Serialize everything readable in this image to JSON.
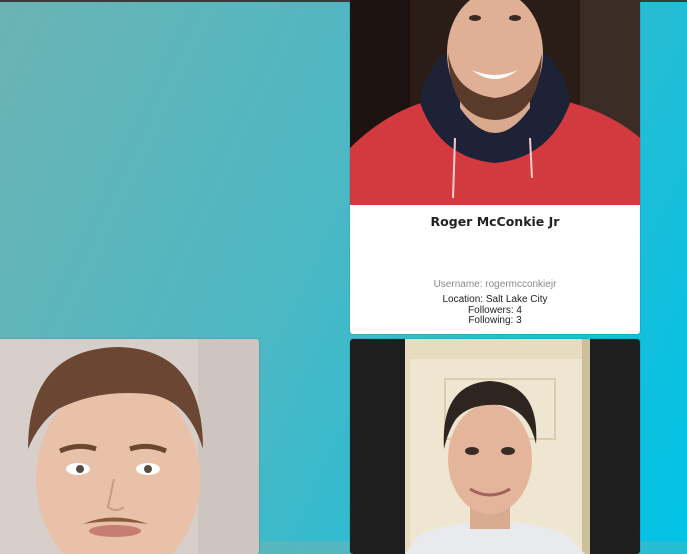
{
  "cards": [
    {
      "name": "Roger McConkie Jr",
      "username_label": "Username: rogermcconkiejr",
      "location_label": "Location: Salt Lake City",
      "followers_label": "Followers: 4",
      "following_label": "Following: 3"
    },
    {
      "name": "",
      "username_label": ""
    },
    {
      "name": "",
      "username_label": ""
    }
  ],
  "colors": {
    "background_start": "#6cb3b3",
    "background_end": "#00c3e6",
    "card_background": "#ffffff"
  }
}
